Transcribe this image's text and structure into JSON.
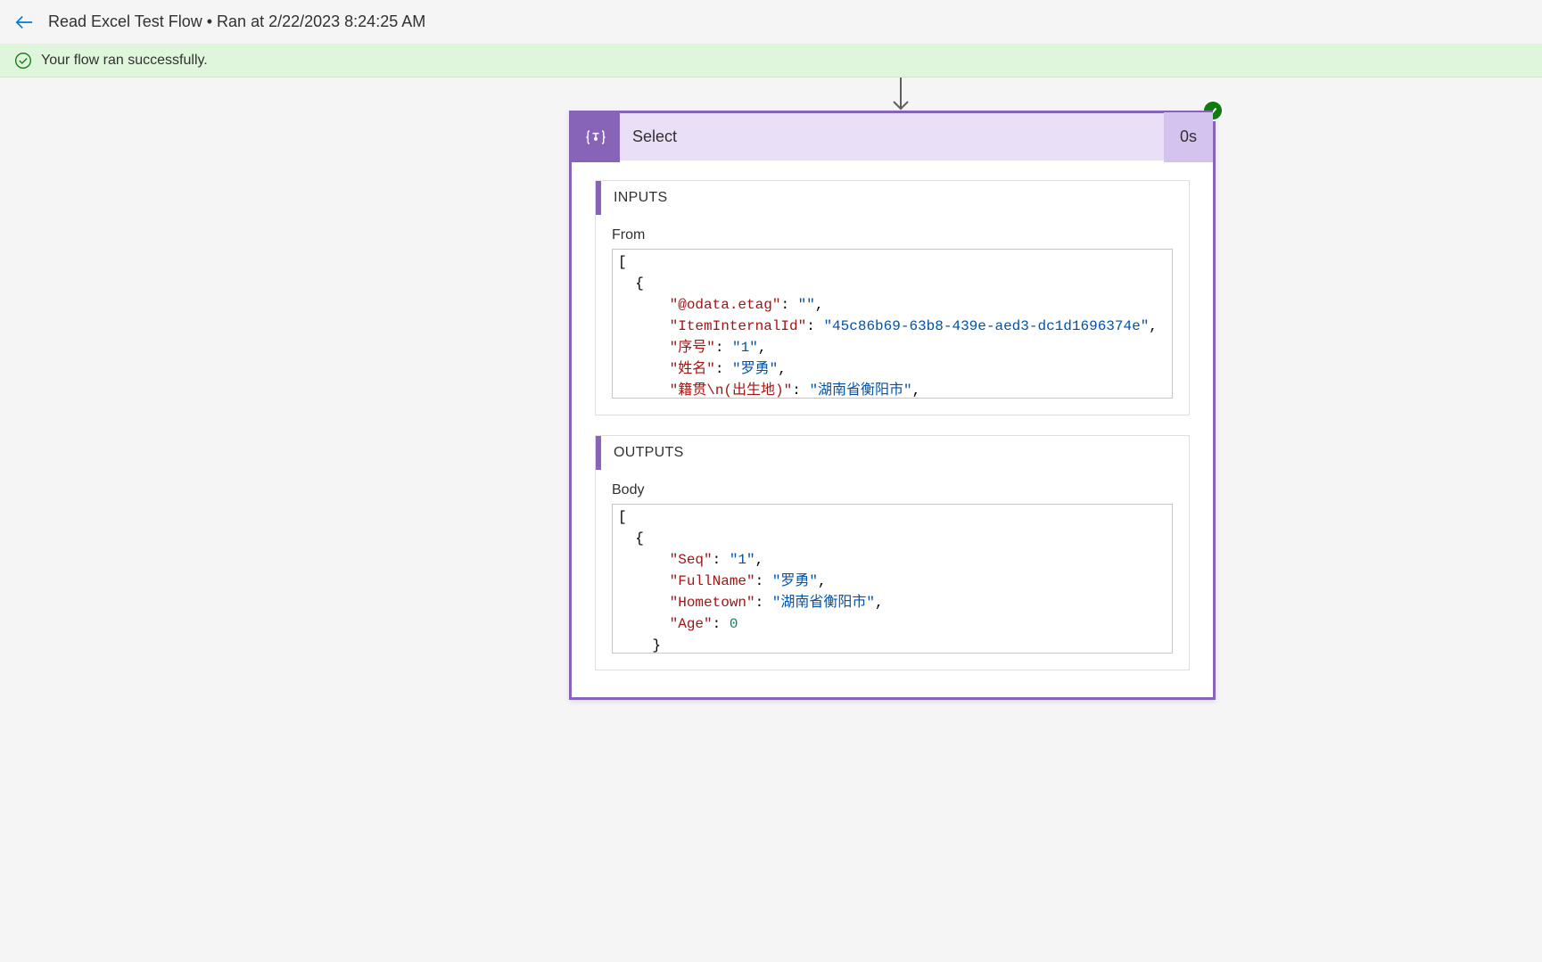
{
  "header": {
    "title": "Read Excel Test Flow • Ran at 2/22/2023 8:24:25 AM"
  },
  "banner": {
    "message": "Your flow ran successfully."
  },
  "card": {
    "title": "Select",
    "duration": "0s",
    "inputs": {
      "header": "INPUTS",
      "from_label": "From",
      "from_data": [
        {
          "@odata.etag": "",
          "ItemInternalId": "45c86b69-63b8-439e-aed3-dc1d1696374e",
          "序号": "1",
          "姓名": "罗勇",
          "籍贯\\n(出生地)": "湖南省衡阳市",
          "年龄": ""
        }
      ]
    },
    "outputs": {
      "header": "OUTPUTS",
      "body_label": "Body",
      "body_data": [
        {
          "Seq": "1",
          "FullName": "罗勇",
          "Hometown": "湖南省衡阳市",
          "Age": 0
        }
      ]
    }
  }
}
